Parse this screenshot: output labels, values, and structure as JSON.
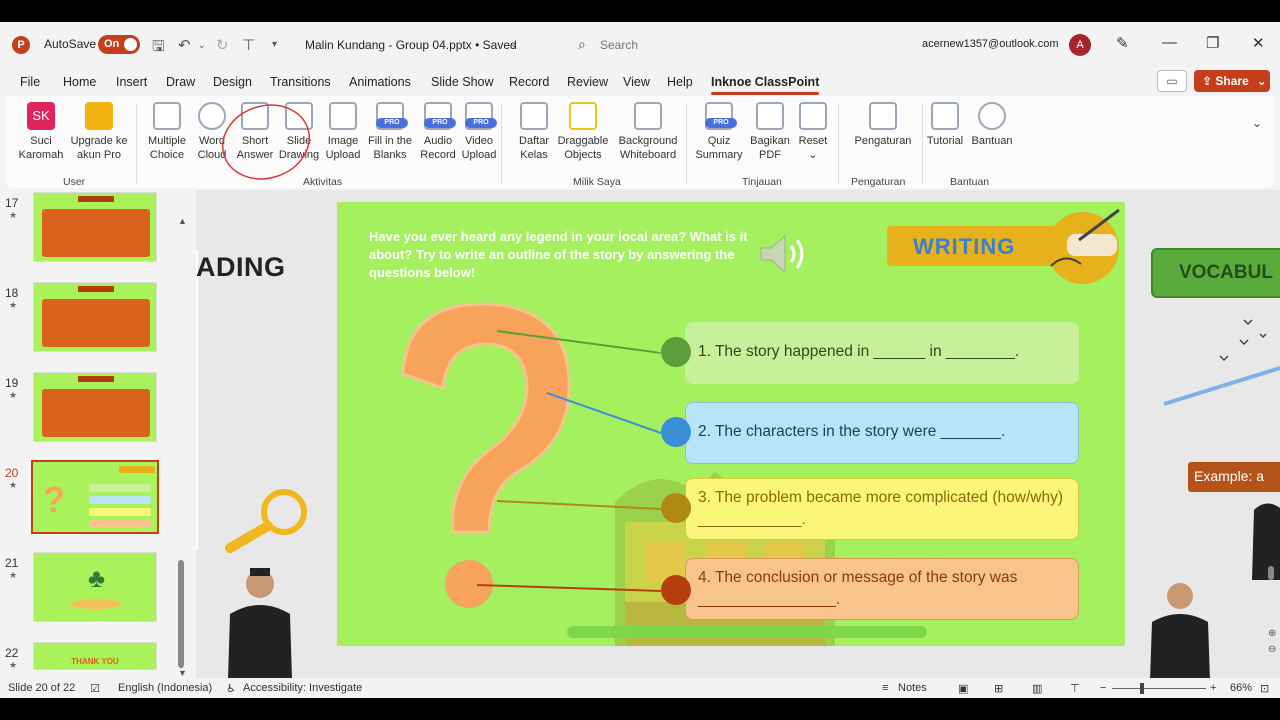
{
  "titlebar": {
    "autosave_label": "AutoSave",
    "autosave_state": "On",
    "doc_title": "Malin Kundang - Group 04.pptx • Saved",
    "search_placeholder": "Search",
    "account_email": "acernew1357@outlook.com",
    "avatar_initial": "A"
  },
  "menu": {
    "tabs": [
      "File",
      "Home",
      "Insert",
      "Draw",
      "Design",
      "Transitions",
      "Animations",
      "Slide Show",
      "Record",
      "Review",
      "View",
      "Help",
      "Inknoe ClassPoint"
    ],
    "active": "Inknoe ClassPoint",
    "share_label": "Share"
  },
  "ribbon": {
    "items": [
      {
        "line1": "Suci",
        "line2": "Karomah",
        "icon": "user-avatar-icon",
        "badge": "SK",
        "color": "#e0245e"
      },
      {
        "line1": "Upgrade ke",
        "line2": "akun Pro",
        "icon": "crown-icon",
        "color": "#f2b20f"
      },
      {
        "line1": "Multiple",
        "line2": "Choice",
        "icon": "multiple-choice-icon",
        "color": "#9aa7b6"
      },
      {
        "line1": "Word",
        "line2": "Cloud",
        "icon": "word-cloud-icon",
        "color": "#9aa7b6"
      },
      {
        "line1": "Short",
        "line2": "Answer",
        "icon": "short-answer-icon",
        "color": "#9aa7b6"
      },
      {
        "line1": "Slide",
        "line2": "Drawing",
        "icon": "slide-drawing-icon",
        "color": "#9aa7b6"
      },
      {
        "line1": "Image",
        "line2": "Upload",
        "icon": "image-upload-icon",
        "color": "#9aa7b6"
      },
      {
        "line1": "Fill in the",
        "line2": "Blanks",
        "icon": "fill-blanks-icon",
        "color": "#9aa7b6",
        "pro": true
      },
      {
        "line1": "Audio",
        "line2": "Record",
        "icon": "audio-record-icon",
        "color": "#9aa7b6",
        "pro": true
      },
      {
        "line1": "Video",
        "line2": "Upload",
        "icon": "video-upload-icon",
        "color": "#9aa7b6",
        "pro": true
      },
      {
        "line1": "Daftar",
        "line2": "Kelas",
        "icon": "class-list-icon",
        "color": "#9aa7b6"
      },
      {
        "line1": "Draggable",
        "line2": "Objects",
        "icon": "draggable-objects-icon",
        "color": "#e6c619"
      },
      {
        "line1": "Background",
        "line2": "Whiteboard",
        "icon": "whiteboard-icon",
        "color": "#9aa7b6"
      },
      {
        "line1": "Quiz",
        "line2": "Summary",
        "icon": "quiz-summary-icon",
        "color": "#9aa7b6",
        "pro": true
      },
      {
        "line1": "Bagikan",
        "line2": "PDF",
        "icon": "share-pdf-icon",
        "color": "#9aa7b6"
      },
      {
        "line1": "Reset",
        "line2": "⌄",
        "icon": "reset-icon",
        "color": "#9aa7b6"
      },
      {
        "line1": "Pengaturan",
        "line2": "",
        "icon": "settings-icon",
        "color": "#9aa7b6"
      },
      {
        "line1": "Tutorial",
        "line2": "",
        "icon": "tutorial-icon",
        "color": "#9aa7b6"
      },
      {
        "line1": "Bantuan",
        "line2": "",
        "icon": "help-icon",
        "color": "#9aa7b6"
      }
    ],
    "groups": [
      "User",
      "Aktivitas",
      "Milik Saya",
      "Tinjauan",
      "Pengaturan",
      "Bantuan"
    ]
  },
  "slides_pane": {
    "slides": [
      {
        "num": "17"
      },
      {
        "num": "18"
      },
      {
        "num": "19"
      },
      {
        "num": "20",
        "selected": true
      },
      {
        "num": "21"
      },
      {
        "num": "22",
        "text": "THANK YOU"
      }
    ]
  },
  "slide": {
    "prompt": "Have you ever heard any legend in your local area? What is it about? Try to write an outline of the story by answering the questions below!",
    "banner": "WRITING",
    "questions": [
      {
        "text": "1. The story happened in ______ in ________.",
        "bg": "#c8f09a",
        "border": "#c8f09a",
        "dot": "#5c9e3a",
        "color": "#2a4a17"
      },
      {
        "text": "2. The characters in the story were _______.",
        "bg": "#b9e3f8",
        "border": "#8fbfd8",
        "dot": "#3b8fd6",
        "color": "#1d3e66"
      },
      {
        "text": "3. The problem became more complicated (how/why) ____________.",
        "bg": "#fbf57a",
        "border": "#d5c93a",
        "dot": "#b08a10",
        "color": "#8a6a08"
      },
      {
        "text": "4. The conclusion or message of the story was ________________.",
        "bg": "#f9c38c",
        "border": "#d99a5a",
        "dot": "#b5400d",
        "color": "#8a3a0a"
      }
    ]
  },
  "offslide": {
    "left_title": "ADING",
    "right_button": "VOCABUL",
    "example": "Example: a"
  },
  "statusbar": {
    "slide_info": "Slide 20 of 22",
    "language": "English (Indonesia)",
    "accessibility": "Accessibility: Investigate",
    "notes": "Notes",
    "zoom": "66%"
  },
  "colors": {
    "accent": "#c43e1c",
    "slide_bg": "#a5f05e",
    "banner": "#e6b11a"
  }
}
